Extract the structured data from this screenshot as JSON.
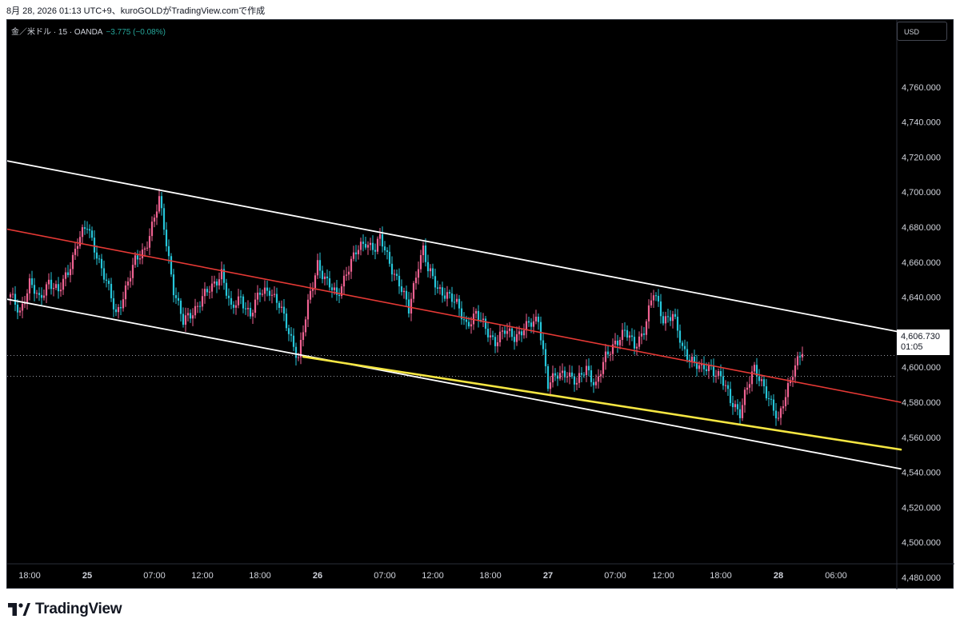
{
  "header": {
    "text": "8月 28, 2026 01:13 UTC+9、kuroGOLDがTradingView.comで作成"
  },
  "symbol": {
    "name": "金／米ドル · 15 · OANDA",
    "change": "−3.775 (−0.08%)"
  },
  "currency_button": "USD",
  "last_price": {
    "value": "4,606.730",
    "countdown": "01:05"
  },
  "brand": {
    "name": "TradingView"
  },
  "colors": {
    "background": "#000000",
    "up": "#f06292",
    "down": "#26c6da",
    "channel": "#ffffff",
    "midline": "#e53935",
    "support": "#f5e642"
  },
  "chart_data": {
    "type": "candlestick",
    "ylim": [
      4470,
      4780
    ],
    "y_ticks": [
      "4,480.000",
      "4,500.000",
      "4,520.000",
      "4,540.000",
      "4,560.000",
      "4,580.000",
      "4,600.000",
      "4,620.000",
      "4,640.000",
      "4,660.000",
      "4,680.000",
      "4,700.000",
      "4,720.000",
      "4,740.000",
      "4,760.000"
    ],
    "x_ticks": [
      {
        "label": "18:00",
        "bar": 8,
        "bold": false
      },
      {
        "label": "25",
        "bar": 32,
        "bold": true
      },
      {
        "label": "07:00",
        "bar": 60,
        "bold": false
      },
      {
        "label": "12:00",
        "bar": 80,
        "bold": false
      },
      {
        "label": "18:00",
        "bar": 104,
        "bold": false
      },
      {
        "label": "26",
        "bar": 128,
        "bold": true
      },
      {
        "label": "07:00",
        "bar": 156,
        "bold": false
      },
      {
        "label": "12:00",
        "bar": 176,
        "bold": false
      },
      {
        "label": "18:00",
        "bar": 200,
        "bold": false
      },
      {
        "label": "27",
        "bar": 224,
        "bold": true
      },
      {
        "label": "07:00",
        "bar": 252,
        "bold": false
      },
      {
        "label": "12:00",
        "bar": 272,
        "bold": false
      },
      {
        "label": "18:00",
        "bar": 296,
        "bold": false
      },
      {
        "label": "28",
        "bar": 320,
        "bold": true
      },
      {
        "label": "06:00",
        "bar": 344,
        "bold": false
      }
    ],
    "anchors": [
      [
        0,
        4640
      ],
      [
        4,
        4632
      ],
      [
        8,
        4648
      ],
      [
        12,
        4638
      ],
      [
        16,
        4650
      ],
      [
        20,
        4642
      ],
      [
        24,
        4655
      ],
      [
        28,
        4672
      ],
      [
        32,
        4680
      ],
      [
        36,
        4665
      ],
      [
        40,
        4648
      ],
      [
        44,
        4630
      ],
      [
        48,
        4645
      ],
      [
        52,
        4660
      ],
      [
        56,
        4668
      ],
      [
        60,
        4685
      ],
      [
        62,
        4695
      ],
      [
        64,
        4680
      ],
      [
        68,
        4645
      ],
      [
        72,
        4625
      ],
      [
        76,
        4632
      ],
      [
        80,
        4640
      ],
      [
        84,
        4645
      ],
      [
        88,
        4655
      ],
      [
        92,
        4632
      ],
      [
        96,
        4640
      ],
      [
        100,
        4630
      ],
      [
        104,
        4642
      ],
      [
        108,
        4645
      ],
      [
        112,
        4635
      ],
      [
        116,
        4620
      ],
      [
        120,
        4606
      ],
      [
        124,
        4635
      ],
      [
        128,
        4660
      ],
      [
        132,
        4648
      ],
      [
        136,
        4640
      ],
      [
        140,
        4655
      ],
      [
        144,
        4665
      ],
      [
        148,
        4672
      ],
      [
        152,
        4668
      ],
      [
        154,
        4673
      ],
      [
        158,
        4660
      ],
      [
        162,
        4648
      ],
      [
        166,
        4632
      ],
      [
        170,
        4660
      ],
      [
        172,
        4668
      ],
      [
        174,
        4655
      ],
      [
        178,
        4645
      ],
      [
        182,
        4642
      ],
      [
        186,
        4635
      ],
      [
        190,
        4625
      ],
      [
        194,
        4630
      ],
      [
        198,
        4622
      ],
      [
        202,
        4615
      ],
      [
        206,
        4620
      ],
      [
        210,
        4618
      ],
      [
        214,
        4622
      ],
      [
        218,
        4625
      ],
      [
        220,
        4628
      ],
      [
        222,
        4610
      ],
      [
        224,
        4590
      ],
      [
        228,
        4595
      ],
      [
        232,
        4598
      ],
      [
        236,
        4590
      ],
      [
        240,
        4600
      ],
      [
        244,
        4590
      ],
      [
        248,
        4605
      ],
      [
        252,
        4615
      ],
      [
        256,
        4620
      ],
      [
        260,
        4612
      ],
      [
        264,
        4622
      ],
      [
        268,
        4642
      ],
      [
        272,
        4628
      ],
      [
        276,
        4630
      ],
      [
        280,
        4610
      ],
      [
        284,
        4605
      ],
      [
        288,
        4598
      ],
      [
        292,
        4600
      ],
      [
        296,
        4595
      ],
      [
        300,
        4580
      ],
      [
        304,
        4575
      ],
      [
        306,
        4585
      ],
      [
        310,
        4598
      ],
      [
        314,
        4590
      ],
      [
        318,
        4575
      ],
      [
        320,
        4568
      ],
      [
        322,
        4580
      ],
      [
        324,
        4590
      ],
      [
        326,
        4598
      ],
      [
        328,
        4603
      ],
      [
        330,
        4608
      ]
    ],
    "lines": [
      {
        "name": "",
        "from": [
          -2,
          4718
        ],
        "to": [
          371,
          4620
        ]
      },
      {
        "name": "",
        "from": [
          -2,
          4679
        ],
        "to": [
          371,
          4580
        ]
      },
      {
        "name": "",
        "from": [
          -2,
          4639
        ],
        "to": [
          371,
          4542
        ]
      },
      {
        "name": "",
        "from": [
          122,
          4606
        ],
        "to": [
          371,
          4553
        ]
      }
    ]
  }
}
